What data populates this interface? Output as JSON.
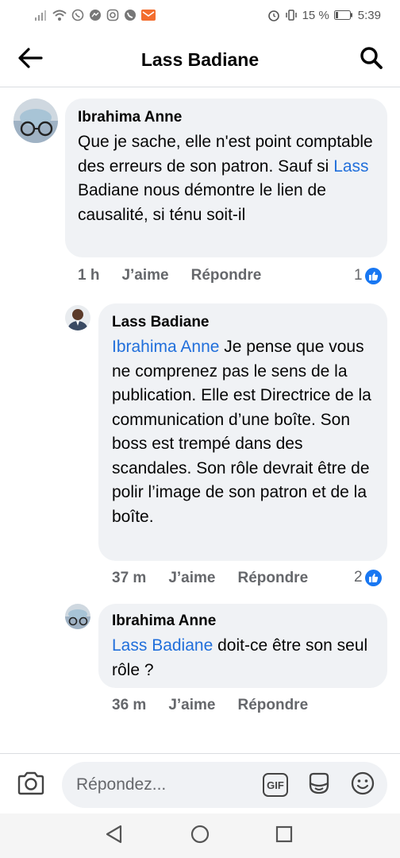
{
  "status_bar": {
    "battery_percent": "15 %",
    "time": "5:39"
  },
  "header": {
    "title": "Lass Badiane",
    "back_icon": "arrow-left-icon",
    "search_icon": "search-icon"
  },
  "comments": [
    {
      "author": "Ibrahima Anne",
      "segments": [
        {
          "text": "Que je sache, elle n'est point comptable des erreurs de son patron. Sauf si ",
          "mention": false
        },
        {
          "text": "Lass",
          "mention": true
        },
        {
          "text": " Badiane nous démontre le lien de causalité, si ténu soit-il",
          "mention": false
        }
      ],
      "time": "1 h",
      "like_label": "J’aime",
      "reply_label": "Répondre",
      "reactions": "1"
    },
    {
      "author": "Lass Badiane",
      "segments": [
        {
          "text": "Ibrahima Anne",
          "mention": true
        },
        {
          "text": " Je pense que vous ne comprenez pas le sens de la publication. Elle est Directrice de la communication d’une boîte. Son boss est trempé dans des scandales. Son rôle devrait être de polir l’image de son patron et de la boîte.",
          "mention": false
        }
      ],
      "time": "37 m",
      "like_label": "J’aime",
      "reply_label": "Répondre",
      "reactions": "2"
    },
    {
      "author": "Ibrahima Anne",
      "segments": [
        {
          "text": "Lass Badiane",
          "mention": true
        },
        {
          "text": " doit-ce être son seul rôle ?",
          "mention": false
        }
      ],
      "time": "36 m",
      "like_label": "J’aime",
      "reply_label": "Répondre"
    }
  ],
  "composer": {
    "placeholder": "Répondez...",
    "gif_label": "GIF"
  },
  "colors": {
    "mention": "#216fdb",
    "bubble": "#f0f2f5",
    "like_badge": "#1877f2",
    "meta": "#65676b"
  }
}
